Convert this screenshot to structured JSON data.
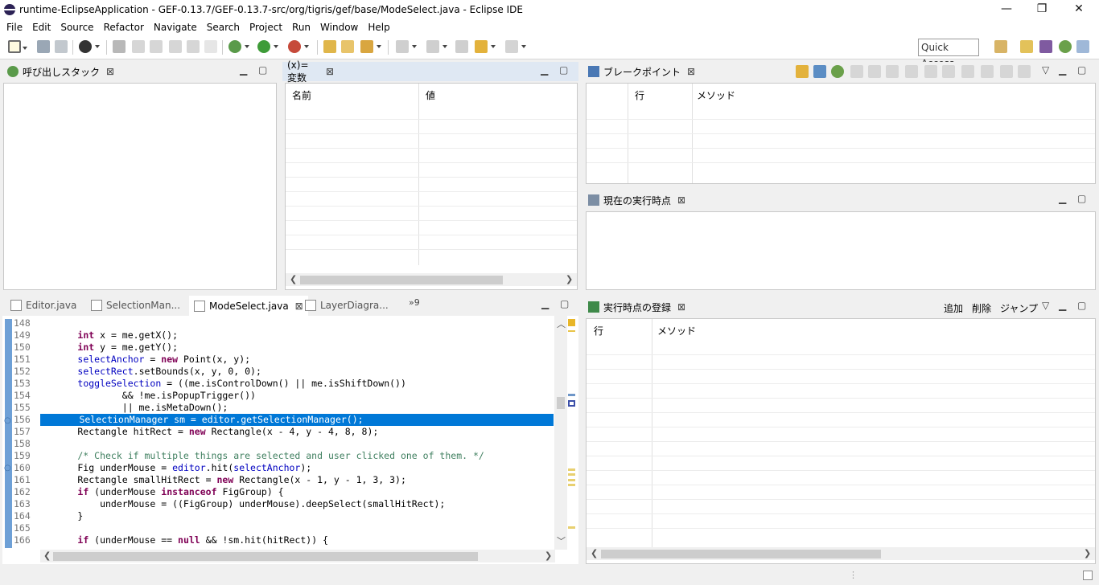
{
  "window": {
    "title": "runtime-EclipseApplication - GEF-0.13.7/GEF-0.13.7-src/org/tigris/gef/base/ModeSelect.java - Eclipse IDE",
    "minimize": "—",
    "restore": "❐",
    "close": "✕"
  },
  "menu": [
    "File",
    "Edit",
    "Source",
    "Refactor",
    "Navigate",
    "Search",
    "Project",
    "Run",
    "Window",
    "Help"
  ],
  "toolbar": {
    "quick_access": "Quick Access"
  },
  "callstack": {
    "tab": "呼び出しスタック"
  },
  "variables": {
    "tab": "(x)= 変数",
    "col_name": "名前",
    "col_value": "値"
  },
  "breakpoints": {
    "tab": "ブレークポイント",
    "col_line": "行",
    "col_method": "メソッド"
  },
  "current": {
    "tab": "現在の実行時点"
  },
  "registry": {
    "tab": "実行時点の登録",
    "add": "追加",
    "delete": "削除",
    "jump": "ジャンプ",
    "col_line": "行",
    "col_method": "メソッド"
  },
  "editor": {
    "tabs": [
      "Editor.java",
      "SelectionMan...",
      "ModeSelect.java",
      "LayerDiagra..."
    ],
    "overflow": "»9",
    "lines": [
      {
        "n": "148",
        "t": ""
      },
      {
        "n": "149",
        "t": "        int x = me.getX();"
      },
      {
        "n": "150",
        "t": "        int y = me.getY();"
      },
      {
        "n": "151",
        "t": "        selectAnchor = new Point(x, y);"
      },
      {
        "n": "152",
        "t": "        selectRect.setBounds(x, y, 0, 0);"
      },
      {
        "n": "153",
        "t": "        toggleSelection = ((me.isControlDown() || me.isShiftDown())"
      },
      {
        "n": "154",
        "t": "                && !me.isPopupTrigger())"
      },
      {
        "n": "155",
        "t": "                || me.isMetaDown();"
      },
      {
        "n": "156",
        "t": "        SelectionManager sm = editor.getSelectionManager();"
      },
      {
        "n": "157",
        "t": "        Rectangle hitRect = new Rectangle(x - 4, y - 4, 8, 8);"
      },
      {
        "n": "158",
        "t": ""
      },
      {
        "n": "159",
        "t": "        /* Check if multiple things are selected and user clicked one of them. */"
      },
      {
        "n": "160",
        "t": "        Fig underMouse = editor.hit(selectAnchor);"
      },
      {
        "n": "161",
        "t": "        Rectangle smallHitRect = new Rectangle(x - 1, y - 1, 3, 3);"
      },
      {
        "n": "162",
        "t": "        if (underMouse instanceof FigGroup) {"
      },
      {
        "n": "163",
        "t": "            underMouse = ((FigGroup) underMouse).deepSelect(smallHitRect);"
      },
      {
        "n": "164",
        "t": "        }"
      },
      {
        "n": "165",
        "t": ""
      },
      {
        "n": "166",
        "t": "        if (underMouse == null && !sm.hit(hitRect)) {"
      }
    ]
  },
  "colors": {
    "selection": "#0078d7",
    "keyword": "#7f0055",
    "field": "#0000c0",
    "comment": "#3f7f5f"
  }
}
